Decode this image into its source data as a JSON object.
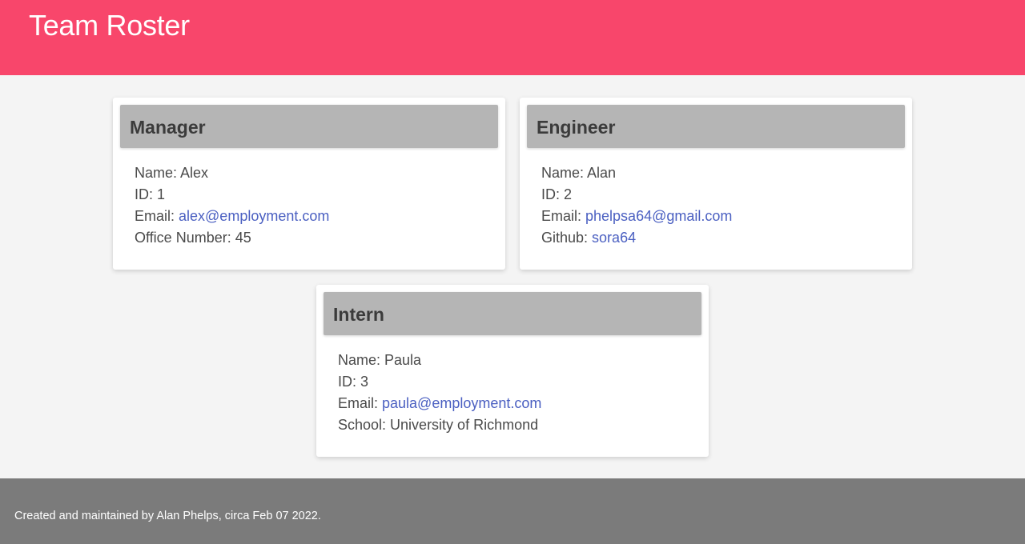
{
  "header": {
    "title": "Team Roster"
  },
  "cards": [
    {
      "role": "Manager",
      "name_label": "Name: ",
      "name": "Alex",
      "id_label": "ID: ",
      "id": "1",
      "email_label": "Email: ",
      "email": "alex@employment.com",
      "extra_label": "Office Number: ",
      "extra": "45"
    },
    {
      "role": "Engineer",
      "name_label": "Name: ",
      "name": "Alan",
      "id_label": "ID: ",
      "id": "2",
      "email_label": "Email: ",
      "email": "phelpsa64@gmail.com",
      "extra_label": "Github: ",
      "extra": "sora64"
    },
    {
      "role": "Intern",
      "name_label": "Name: ",
      "name": "Paula",
      "id_label": "ID: ",
      "id": "3",
      "email_label": "Email: ",
      "email": "paula@employment.com",
      "extra_label": "School: ",
      "extra": "University of Richmond"
    }
  ],
  "footer": {
    "text": "Created and maintained by Alan Phelps, circa Feb 07 2022."
  },
  "colors": {
    "header_bg": "#f8466b",
    "card_header_bg": "#b5b5b5",
    "link": "#4a5fc1",
    "footer_bg": "#7b7b7b",
    "page_bg": "#f4f4f4"
  }
}
